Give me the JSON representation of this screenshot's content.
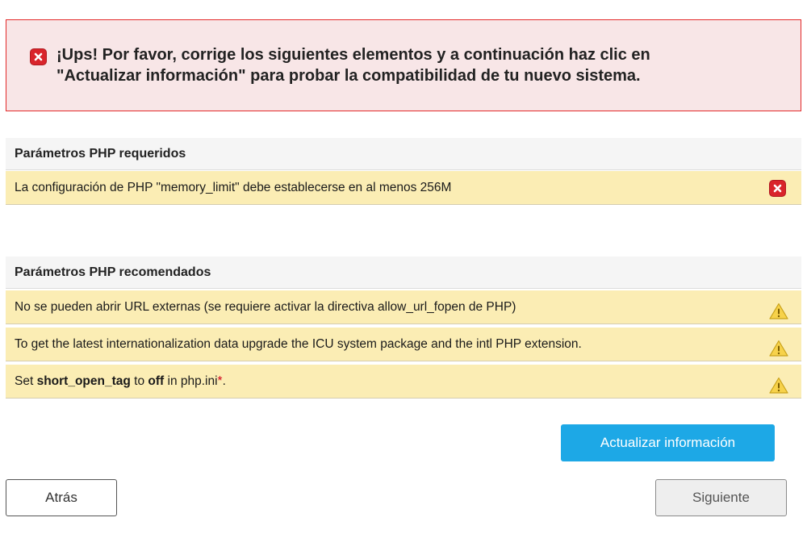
{
  "alert": {
    "icon": "error-icon",
    "text_line1": "¡Ups! Por favor, corrige los siguientes elementos y a continuación haz clic en",
    "text_line2": "\"Actualizar información\" para probar la compatibilidad de tu nuevo sistema."
  },
  "required": {
    "header": "Parámetros PHP requeridos",
    "rows": [
      {
        "text": "La configuración de PHP \"memory_limit\" debe establecerse en al menos 256M",
        "status_icon": "error-icon"
      }
    ]
  },
  "recommended": {
    "header": "Parámetros PHP recomendados",
    "rows": [
      {
        "text": "No se pueden abrir URL externas (se requiere activar la directiva allow_url_fopen de PHP)",
        "status_icon": "warning-icon"
      },
      {
        "text": "To get the latest internationalization data upgrade the ICU system package and the intl PHP extension.",
        "status_icon": "warning-icon"
      },
      {
        "text_pre": "Set ",
        "text_bold1": "short_open_tag",
        "text_mid": " to ",
        "text_bold2": "off",
        "text_post": " in php.ini",
        "text_mark": "*",
        "text_end": ".",
        "status_icon": "warning-icon"
      }
    ]
  },
  "buttons": {
    "refresh_label": "Actualizar información",
    "back_label": "Atrás",
    "next_label": "Siguiente"
  },
  "colors": {
    "alert_border": "#e32b2b",
    "alert_bg": "#f8e6e7",
    "row_bg": "#fbedb4",
    "primary": "#1da8e6",
    "error": "#d9242b",
    "warning": "#f5c518"
  }
}
